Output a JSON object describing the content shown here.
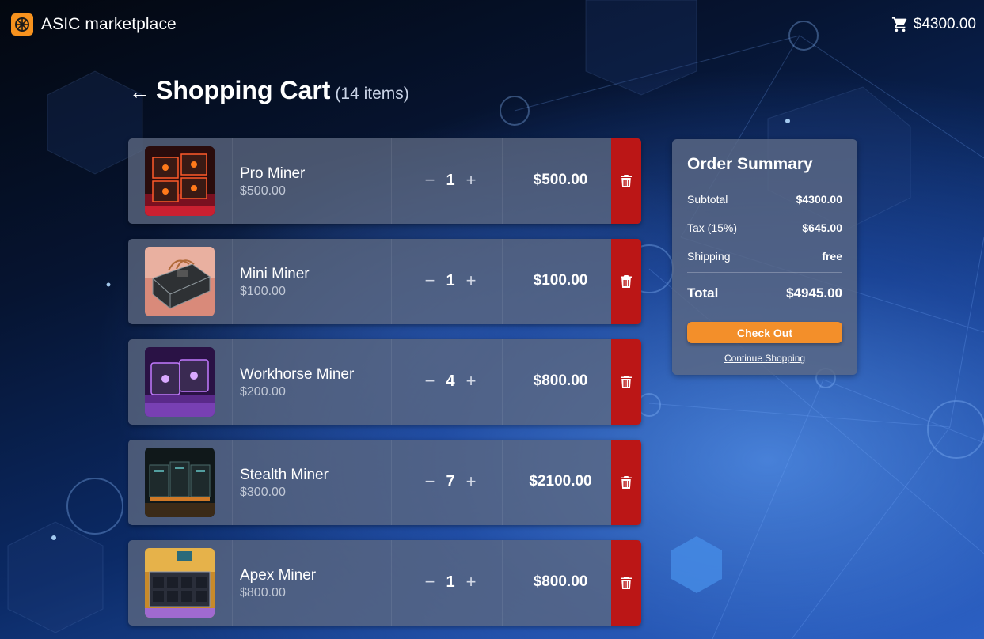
{
  "header": {
    "brand": "ASIC marketplace",
    "cart_total": "$4300.00",
    "brand_color": "#f7921e"
  },
  "page": {
    "title": "Shopping Cart",
    "item_count": "(14 items)"
  },
  "cart": {
    "items": [
      {
        "name": "Pro Miner",
        "unit_price": "$500.00",
        "qty": "1",
        "line_total": "$500.00",
        "image": "pro-miner-image"
      },
      {
        "name": "Mini Miner",
        "unit_price": "$100.00",
        "qty": "1",
        "line_total": "$100.00",
        "image": "mini-miner-image"
      },
      {
        "name": "Workhorse Miner",
        "unit_price": "$200.00",
        "qty": "4",
        "line_total": "$800.00",
        "image": "workhorse-miner-image"
      },
      {
        "name": "Stealth Miner",
        "unit_price": "$300.00",
        "qty": "7",
        "line_total": "$2100.00",
        "image": "stealth-miner-image"
      },
      {
        "name": "Apex Miner",
        "unit_price": "$800.00",
        "qty": "1",
        "line_total": "$800.00",
        "image": "apex-miner-image"
      }
    ],
    "decrement_symbol": "−",
    "increment_symbol": "+"
  },
  "summary": {
    "title": "Order Summary",
    "subtotal_label": "Subtotal",
    "subtotal_value": "$4300.00",
    "tax_label": "Tax (15%)",
    "tax_value": "$645.00",
    "shipping_label": "Shipping",
    "shipping_value": "free",
    "total_label": "Total",
    "total_value": "$4945.00",
    "checkout_label": "Check Out",
    "continue_label": "Continue Shopping",
    "checkout_color": "#f38f2a"
  },
  "colors": {
    "delete": "#bb1616"
  }
}
